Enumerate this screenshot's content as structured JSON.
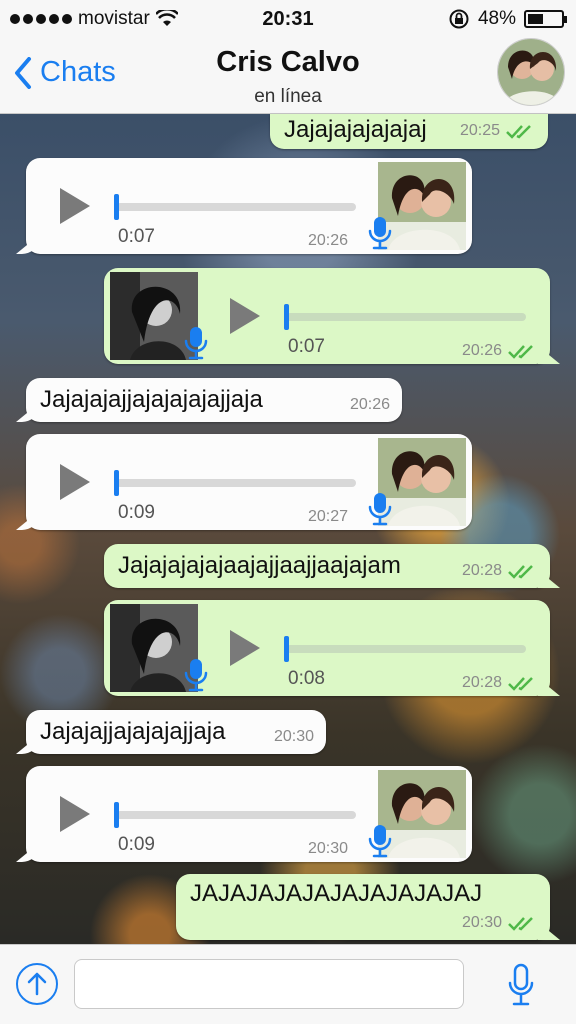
{
  "status_bar": {
    "carrier": "movistar",
    "time": "20:31",
    "battery_percent": "48%",
    "battery_level": 0.48,
    "icons": [
      "signal-dots-icon",
      "wifi-icon",
      "rotation-lock-icon",
      "battery-icon"
    ]
  },
  "nav": {
    "back_label": "Chats",
    "contact_name": "Cris Calvo",
    "status": "en línea"
  },
  "messages": [
    {
      "type": "text",
      "direction": "out",
      "text": "Jajajajajajajaj",
      "time": "20:25"
    },
    {
      "type": "voice",
      "direction": "in",
      "duration": "0:07",
      "time": "20:26",
      "progress": 0
    },
    {
      "type": "voice",
      "direction": "out",
      "duration": "0:07",
      "time": "20:26",
      "progress": 0
    },
    {
      "type": "text",
      "direction": "in",
      "text": "Jajajajajjajajajajajjaja",
      "time": "20:26"
    },
    {
      "type": "voice",
      "direction": "in",
      "duration": "0:09",
      "time": "20:27",
      "progress": 0
    },
    {
      "type": "text",
      "direction": "out",
      "text": "Jajajajajajaajajjaajjaajajam",
      "time": "20:28"
    },
    {
      "type": "voice",
      "direction": "out",
      "duration": "0:08",
      "time": "20:28",
      "progress": 0
    },
    {
      "type": "text",
      "direction": "in",
      "text": "Jajajajjajajajajjaja",
      "time": "20:30"
    },
    {
      "type": "voice",
      "direction": "in",
      "duration": "0:09",
      "time": "20:30",
      "progress": 0
    },
    {
      "type": "text",
      "direction": "out",
      "text": "JAJAJAJAJAJAJAJAJAJAJ",
      "time": "20:30"
    }
  ],
  "input": {
    "placeholder": ""
  },
  "colors": {
    "accent": "#1a7ef0",
    "outgoing_bubble": "#dcf8c6",
    "incoming_bubble": "#fcfcfc",
    "read_checks": "#4fb848"
  }
}
